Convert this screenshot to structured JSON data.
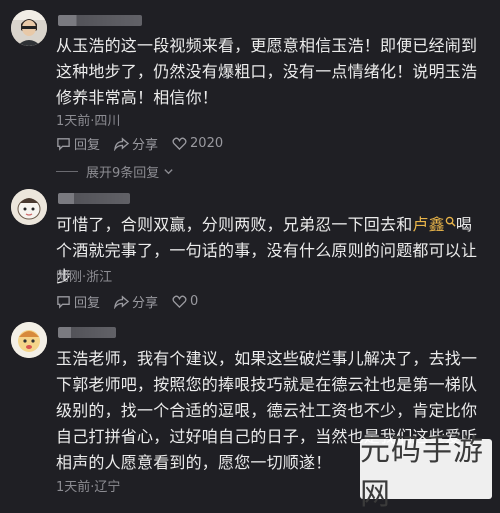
{
  "comments": [
    {
      "text": "从玉浩的这一段视频来看，更愿意相信玉浩！即便已经闹到这种地步了，仍然没有爆粗口，没有一点情绪化！说明玉浩修养非常高！相信你！",
      "meta": "1天前·四川",
      "reply_label": "回复",
      "share_label": "分享",
      "like_count": "2020",
      "expand_label": "展开9条回复"
    },
    {
      "text_before": "可惜了，合则双赢，分则两败，兄弟忍一下回去和",
      "highlight": "卢鑫",
      "text_after": "喝个酒就完事了，一句话的事，没有什么原则的问题都可以让步",
      "meta": "刚刚·浙江",
      "reply_label": "回复",
      "share_label": "分享",
      "like_count": "0"
    },
    {
      "text": "玉浩老师，我有个建议，如果这些破烂事儿解决了，去找一下郭老师吧，按照您的捧哏技巧就是在德云社也是第一梯队级别的，找一个合适的逗哏，德云社工资也不少，肯定比你自己打拼省心，过好咱自己的日子，当然也是我们这些爱听相声的人愿意看到的，愿您一切顺遂！",
      "meta": "1天前·辽宁"
    }
  ],
  "watermark": "元码手游网",
  "colors": {
    "background": "#1f1f24",
    "highlight": "#e8b44a",
    "meta": "#8c8c92"
  }
}
